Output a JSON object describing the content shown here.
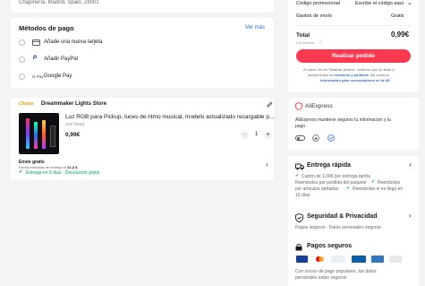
{
  "address": {
    "text": "Chapinería, Madrid, Spain, 28001"
  },
  "payment": {
    "title": "Métodos de pago",
    "see_more": "Ver más",
    "methods": [
      {
        "label": "Añade una nueva tarjeta",
        "icon": "credit-card-icon"
      },
      {
        "label": "Añadir PayPal",
        "icon": "paypal-icon"
      },
      {
        "label": "Google Pay",
        "icon": "google-pay-icon"
      }
    ]
  },
  "store": {
    "badge": "Choice",
    "name": "Dreammaker Lights Store",
    "product": {
      "title": "Luz RGB para Pickup, luces de ritmo musical, modelo actualizado recargable por USB, dec...",
      "variant": "one head",
      "price": "0,99€",
      "quantity": "1"
    },
    "shipping_free": "Envío gratis",
    "shipping_estimate_prefix": "Fecha estimada de entrega el ",
    "shipping_estimate_date": "21 jl 3.",
    "delivery_line": "Entrega en 5 días · Devolución gratis"
  },
  "summary": {
    "promo_label": "Código promocional",
    "promo_placeholder": "Escribe el código aquí",
    "shipping_label": "Gastos de envío",
    "shipping_value": "Gratis",
    "total_label": "Total",
    "total_value": "0,99€",
    "vat_note": "IVA incluido",
    "order_button": "Realizar pedido",
    "terms_1": "Al hacer clic en 'Realizar pedido', confirmo que he leído y",
    "terms_2_prefix": "acepto todos los ",
    "terms_2_link": "términos y políticas",
    "terms_2_suffix": ", así como la",
    "terms_3_link": "información para consumidores en la UE."
  },
  "trust": {
    "brand": "AliExpress",
    "text_1": "AliExpress mantiene seguros tu información y tu",
    "text_2": "pago"
  },
  "fast_delivery": {
    "title": "Entrega rápida",
    "line_1": "Cupón de 1,00€ por entrega tardía",
    "line_2a": "Reembolso por pérdida del paquete",
    "line_2b": "Reembolso",
    "line_3a": "por artículos dañados",
    "line_3b": "Reembolso si no llega en",
    "line_4": "15 días"
  },
  "privacy": {
    "title": "Seguridad & Privacidad",
    "subtitle": "Pagos seguros · Datos personales seguros"
  },
  "secure_payments": {
    "title": "Pagos seguros",
    "text_1": "Con socios de pago populares, tus datos",
    "text_2": "personales están seguros"
  },
  "colors": {
    "accent": "#fd384f",
    "link": "#2e6bd8",
    "green": "#00a65a"
  }
}
